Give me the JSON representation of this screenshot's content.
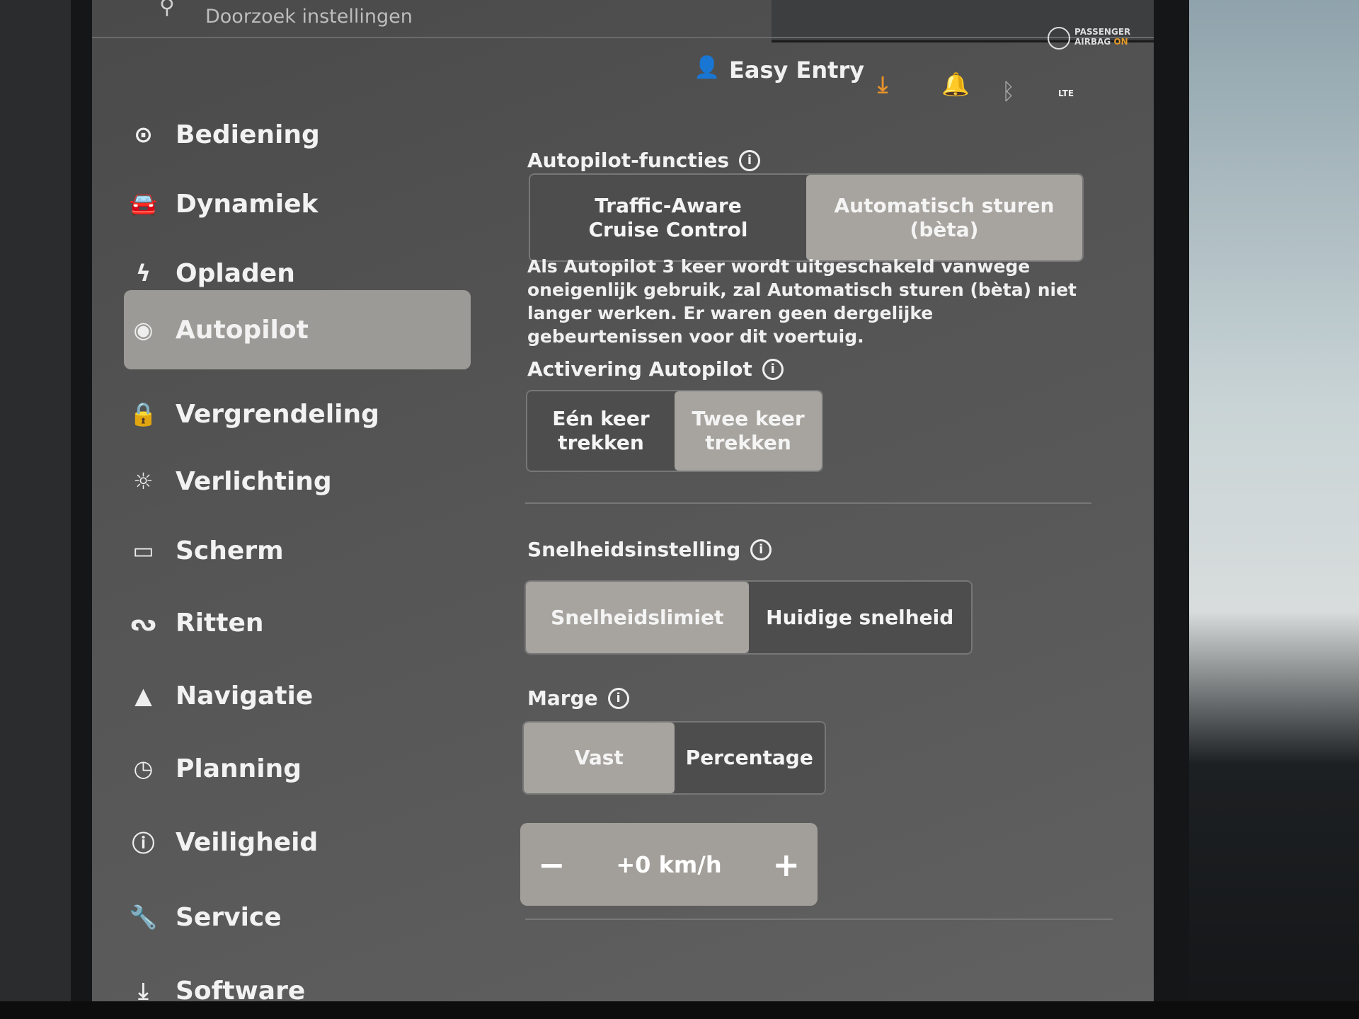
{
  "search": {
    "placeholder": "Doorzoek instellingen"
  },
  "status": {
    "profile": "Easy Entry",
    "airbag_line1": "PASSENGER",
    "airbag_line2": "AIRBAG",
    "airbag_state": "ON",
    "network": "LTE",
    "accent": "#e8922a"
  },
  "sidebar": {
    "items": [
      {
        "label": "Bediening",
        "icon": "toggle-icon",
        "glyph": "⊙"
      },
      {
        "label": "Dynamiek",
        "icon": "car-icon",
        "glyph": "🚘"
      },
      {
        "label": "Opladen",
        "icon": "lightning-icon",
        "glyph": "ϟ"
      },
      {
        "label": "Autopilot",
        "icon": "steering-wheel-icon",
        "glyph": "◉",
        "active": true
      },
      {
        "label": "Vergrendeling",
        "icon": "lock-icon",
        "glyph": "🔒"
      },
      {
        "label": "Verlichting",
        "icon": "light-icon",
        "glyph": "☼"
      },
      {
        "label": "Scherm",
        "icon": "screen-icon",
        "glyph": "▭"
      },
      {
        "label": "Ritten",
        "icon": "trips-icon",
        "glyph": "ᔓ"
      },
      {
        "label": "Navigatie",
        "icon": "navigation-icon",
        "glyph": "▲"
      },
      {
        "label": "Planning",
        "icon": "clock-icon",
        "glyph": "◷"
      },
      {
        "label": "Veiligheid",
        "icon": "safety-icon",
        "glyph": "ⓘ"
      },
      {
        "label": "Service",
        "icon": "wrench-icon",
        "glyph": "🔧"
      },
      {
        "label": "Software",
        "icon": "download-icon",
        "glyph": "⤓"
      }
    ]
  },
  "main": {
    "autopilot_features": {
      "title": "Autopilot-functies",
      "options": [
        "Traffic-Aware\nCruise Control",
        "Automatisch sturen (bèta)"
      ],
      "selected": 1
    },
    "notice": "Als Autopilot 3 keer wordt uitgeschakeld vanwege oneigenlijk gebruik, zal Automatisch sturen (bèta) niet langer werken. Er waren geen dergelijke gebeurtenissen voor dit voertuig.",
    "activation": {
      "title": "Activering Autopilot",
      "options": [
        "Eén keer\ntrekken",
        "Twee keer\ntrekken"
      ],
      "selected": 1
    },
    "speed": {
      "title": "Snelheidsinstelling",
      "options": [
        "Snelheidslimiet",
        "Huidige snelheid"
      ],
      "selected": 0
    },
    "margin": {
      "title": "Marge",
      "options": [
        "Vast",
        "Percentage"
      ],
      "selected": 0,
      "value": "+0 km/h",
      "minus": "−",
      "plus": "+"
    }
  }
}
